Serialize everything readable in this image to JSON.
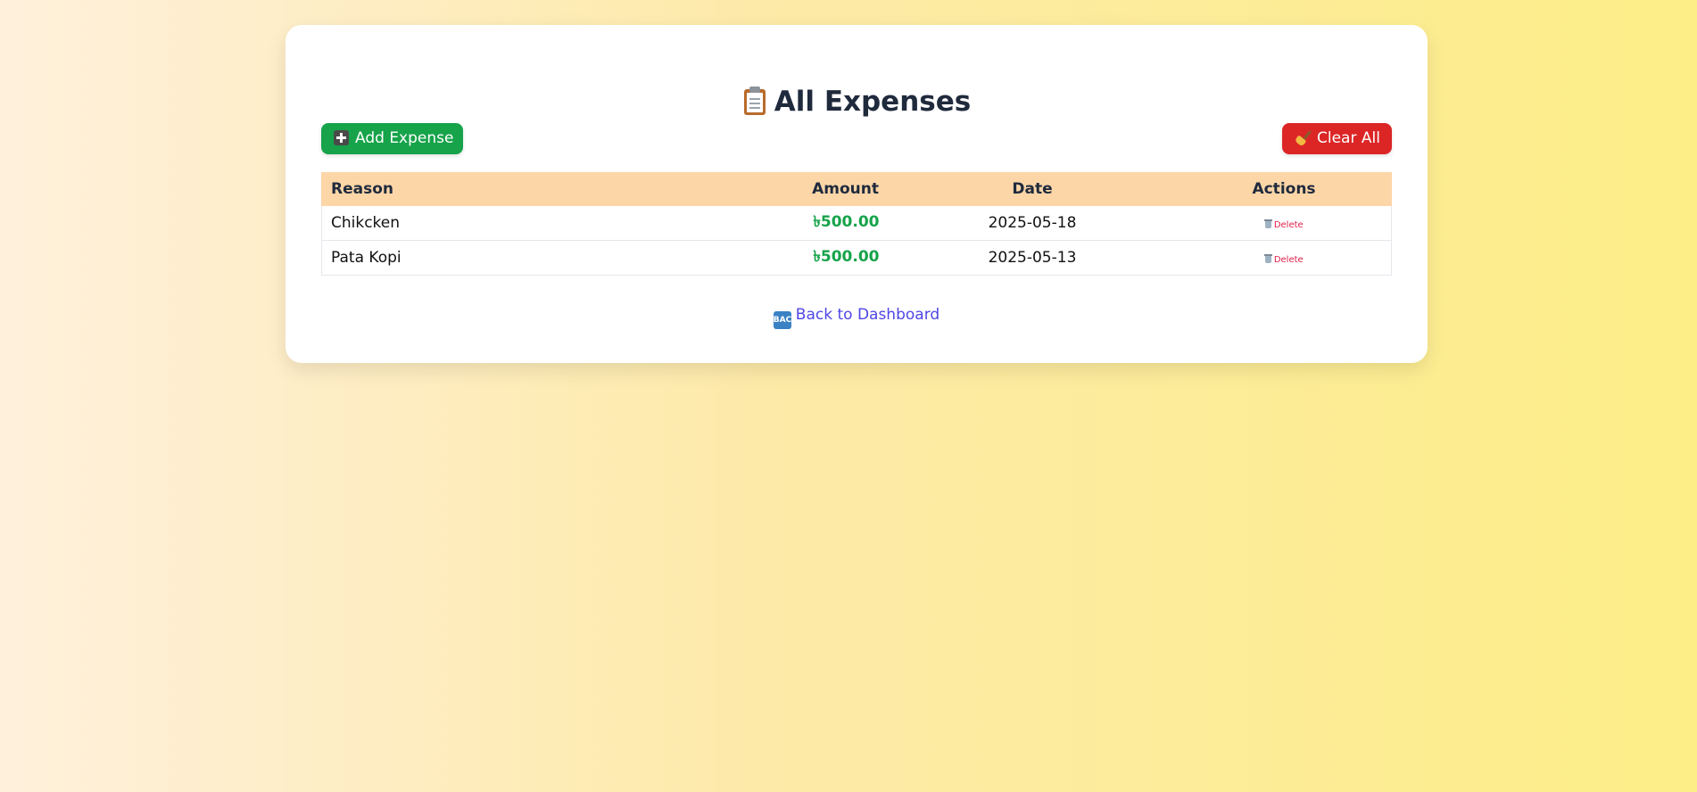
{
  "page": {
    "title": "All Expenses"
  },
  "toolbar": {
    "add_label": "Add Expense",
    "clear_label": "Clear All"
  },
  "table": {
    "headers": [
      "Reason",
      "Amount",
      "Date",
      "Actions"
    ],
    "rows": [
      {
        "reason": "Chikcken",
        "amount": "৳500.00",
        "date": "2025-05-18",
        "action": "Delete"
      },
      {
        "reason": "Pata Kopi",
        "amount": "৳500.00",
        "date": "2025-05-13",
        "action": "Delete"
      }
    ]
  },
  "footer": {
    "back_label": "Back to Dashboard",
    "back_icon_text": "BACK"
  },
  "colors": {
    "add_button": "#16a34a",
    "clear_button": "#dc2626",
    "header_row": "#fdd6a8",
    "amount": "#16a34a",
    "link": "#4f46e5",
    "delete": "#e11d48"
  },
  "icons": {
    "title": "clipboard-icon",
    "add": "plus-icon",
    "clear": "broom-icon",
    "delete": "trash-icon",
    "back": "back-arrow-icon"
  }
}
